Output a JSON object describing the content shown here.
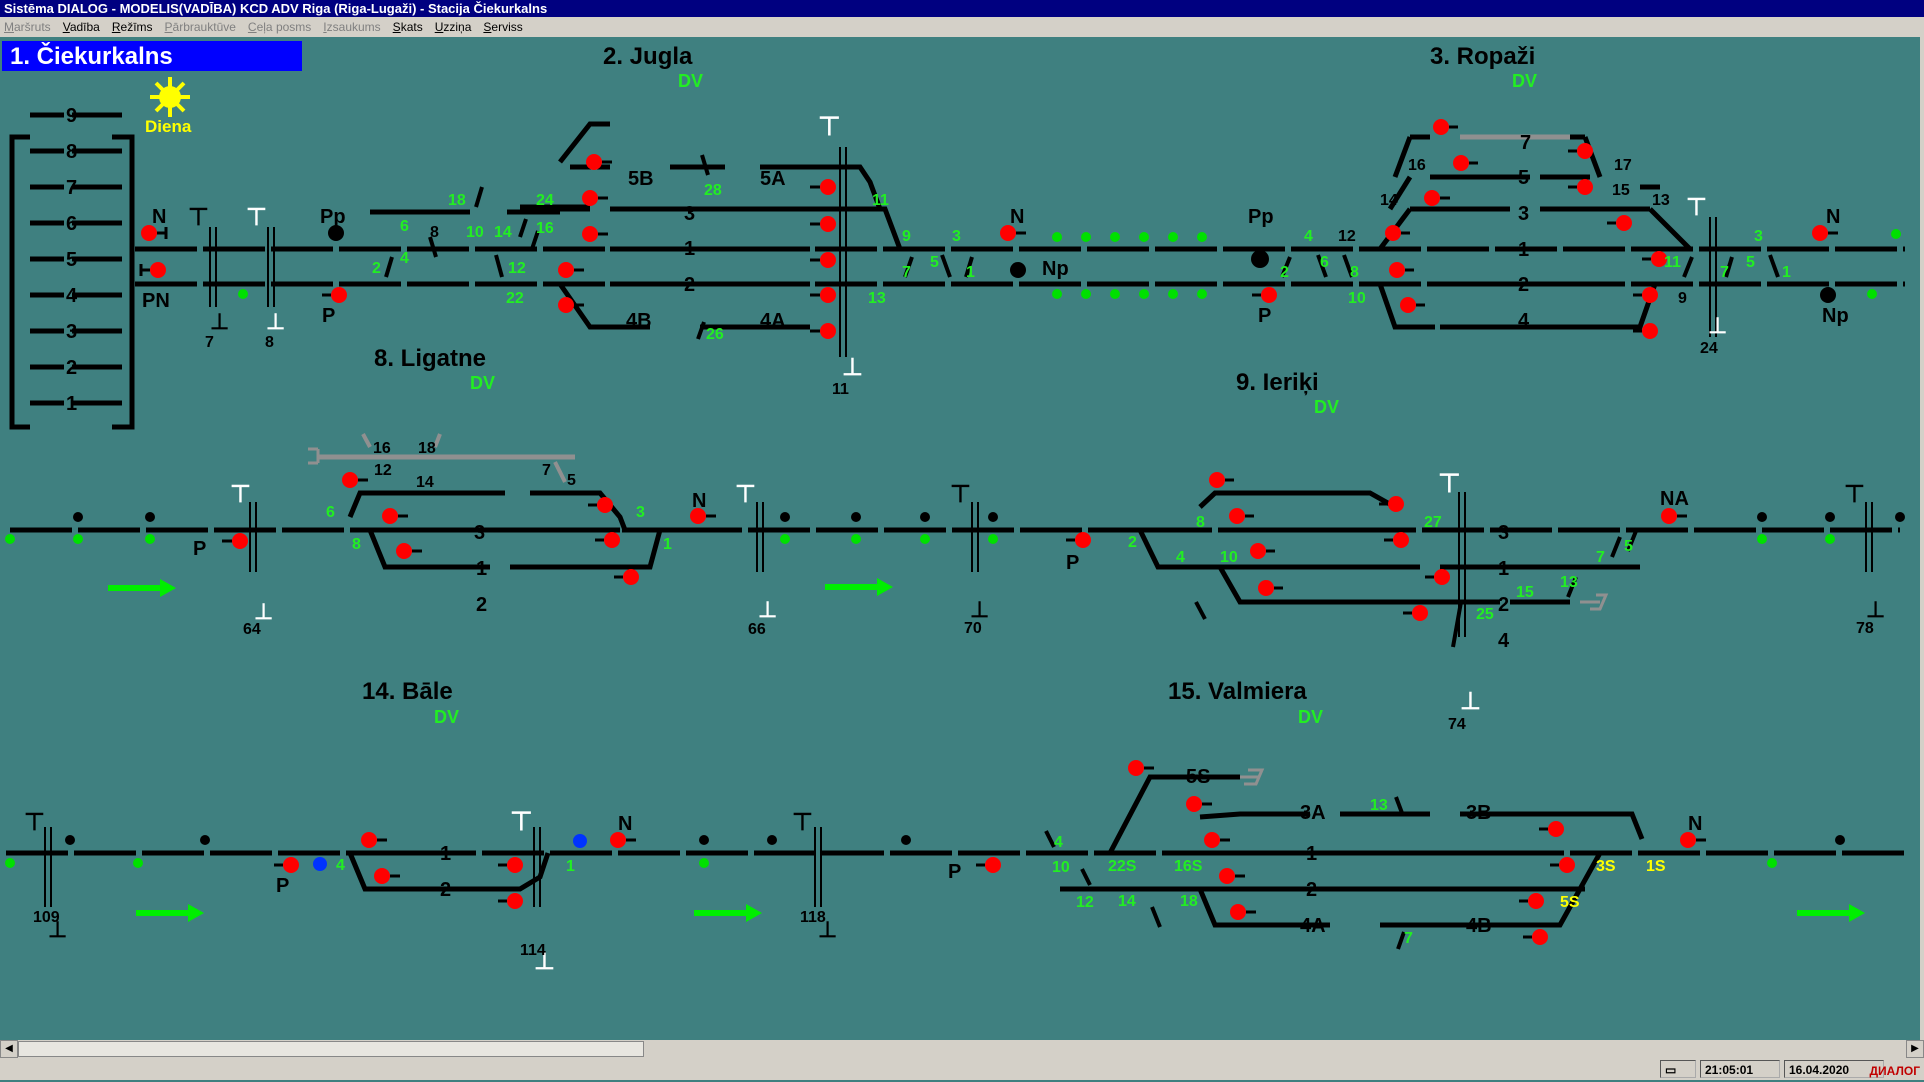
{
  "window": {
    "title": "Sistēma DIALOG - MODELIS(VADĪBA)  KCD ADV Riga (Riga-Lugaži) - Stacija Čiekurkalns"
  },
  "menu": [
    {
      "label": "Maršruts",
      "enabled": false
    },
    {
      "label": "Vadība",
      "enabled": true
    },
    {
      "label": "Režīms",
      "enabled": true
    },
    {
      "label": "Pārbrauktūve",
      "enabled": false
    },
    {
      "label": "Ceļa posms",
      "enabled": false
    },
    {
      "label": "Izsaukums",
      "enabled": false
    },
    {
      "label": "Skats",
      "enabled": true
    },
    {
      "label": "Uzziņa",
      "enabled": true
    },
    {
      "label": "Serviss",
      "enabled": true
    }
  ],
  "header": {
    "station": "1.  Čiekurkalns",
    "mode_label": "Diena"
  },
  "colors": {
    "background": "#3f8080",
    "track": "#000000",
    "signal_red": "#ff0000",
    "signal_green": "#00e000",
    "label_green": "#22ee22",
    "label_yellow": "#ffff00",
    "title_blue": "#0000ff",
    "blue_dot": "#0033ff",
    "grey": "#909090"
  },
  "ladder": [
    "9",
    "8",
    "7",
    "6",
    "5",
    "4",
    "3",
    "2",
    "1"
  ],
  "stations": [
    {
      "title": "2.  Jugla",
      "sub": "DV"
    },
    {
      "title": "3.  Ropaži",
      "sub": "DV"
    },
    {
      "title": "8.  Ligatne",
      "sub": "DV"
    },
    {
      "title": "9.  Ieriķi",
      "sub": "DV"
    },
    {
      "title": "14.  Bāle",
      "sub": "DV"
    },
    {
      "title": "15.  Valmiera",
      "sub": "DV"
    }
  ],
  "labels": {
    "cie": {
      "N": "N",
      "PN": "PN",
      "Pp": "Pp",
      "P": "P",
      "c7": "7",
      "c8": "8"
    },
    "jugla": {
      "t5B": "5B",
      "t5A": "5A",
      "t3": "3",
      "t1": "1",
      "t2": "2",
      "t4B": "4B",
      "t4A": "4A",
      "g18": "18",
      "g24": "24",
      "g16": "16",
      "g6": "6",
      "b8": "8",
      "g10": "10",
      "g14": "14",
      "g12": "12",
      "g22": "22",
      "g2": "2",
      "g4": "4",
      "g28": "28",
      "g26": "26",
      "g11": "11",
      "g13": "13",
      "g9": "9",
      "g3": "3",
      "g7": "7",
      "g5": "5",
      "g1": "1",
      "b11": "11"
    },
    "mid": {
      "N": "N",
      "Np": "Np",
      "Pp": "Pp",
      "P": "P"
    },
    "ropazi": {
      "t7": "7",
      "t5": "5",
      "t3": "3",
      "t1": "1",
      "t2": "2",
      "t4": "4",
      "b16": "16",
      "b17": "17",
      "b14": "14",
      "b15": "15",
      "b13": "13",
      "b12": "12",
      "g4": "4",
      "g2": "2",
      "g6": "6",
      "g8": "8",
      "g10": "10",
      "g11": "11",
      "g7": "7",
      "g5": "5",
      "g1": "1",
      "g3": "3",
      "b9": "9",
      "N": "N",
      "Np": "Np",
      "b24": "24"
    },
    "ligatne": {
      "t3": "3",
      "t1": "1",
      "t2": "2",
      "b16": "16",
      "b18": "18",
      "b12": "12",
      "b14": "14",
      "b7": "7",
      "b5": "5",
      "g6": "6",
      "g8": "8",
      "g3": "3",
      "g1": "1",
      "P": "P",
      "N": "N",
      "b64": "64",
      "b66": "66",
      "b70": "70",
      "P2": "P"
    },
    "ieriki": {
      "t3": "3",
      "t1": "1",
      "t2": "2",
      "t4": "4",
      "g8": "8",
      "g27": "27",
      "g2": "2",
      "g4": "4",
      "g10": "10",
      "g7": "7",
      "g5": "5",
      "g13": "13",
      "g15": "15",
      "g25": "25",
      "b74": "74",
      "NA": "NA",
      "b78": "78"
    },
    "bale": {
      "t1": "1",
      "t2": "2",
      "g4": "4",
      "g1": "1",
      "P": "P",
      "N": "N",
      "b109": "109",
      "b114": "114",
      "b118": "118"
    },
    "valmiera": {
      "t5S": "5S",
      "t3A": "3A",
      "t3B": "3B",
      "t1": "1",
      "t2": "2",
      "t4A": "4A",
      "t4B": "4B",
      "g13": "13",
      "g4": "4",
      "g10": "10",
      "g22S": "22S",
      "g16S": "16S",
      "g12": "12",
      "g14": "14",
      "g18": "18",
      "g7": "7",
      "y3S": "3S",
      "y1S": "1S",
      "y5S": "5S",
      "P": "P",
      "N": "N"
    }
  },
  "status": {
    "time": "21:05:01",
    "date": "16.04.2020",
    "brand": "ДИАЛОГ"
  }
}
